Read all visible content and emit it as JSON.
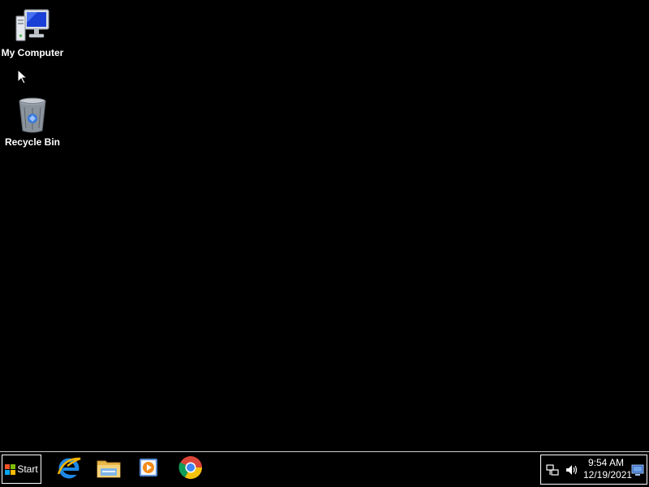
{
  "desktop": {
    "background": "#000000",
    "icons": [
      {
        "label": "My Computer",
        "icon": "computer-icon"
      },
      {
        "label": "Recycle Bin",
        "icon": "recycle-bin-icon"
      }
    ]
  },
  "taskbar": {
    "start_label": "Start",
    "pinned": [
      {
        "name": "Internet Explorer",
        "icon": "internet-explorer-icon"
      },
      {
        "name": "File Explorer",
        "icon": "file-explorer-icon"
      },
      {
        "name": "Media Player",
        "icon": "media-player-icon"
      },
      {
        "name": "Google Chrome",
        "icon": "chrome-icon"
      }
    ],
    "tray": {
      "icons": [
        "network-icon",
        "volume-icon"
      ],
      "time": "9:54 AM",
      "date": "12/19/2021"
    }
  }
}
